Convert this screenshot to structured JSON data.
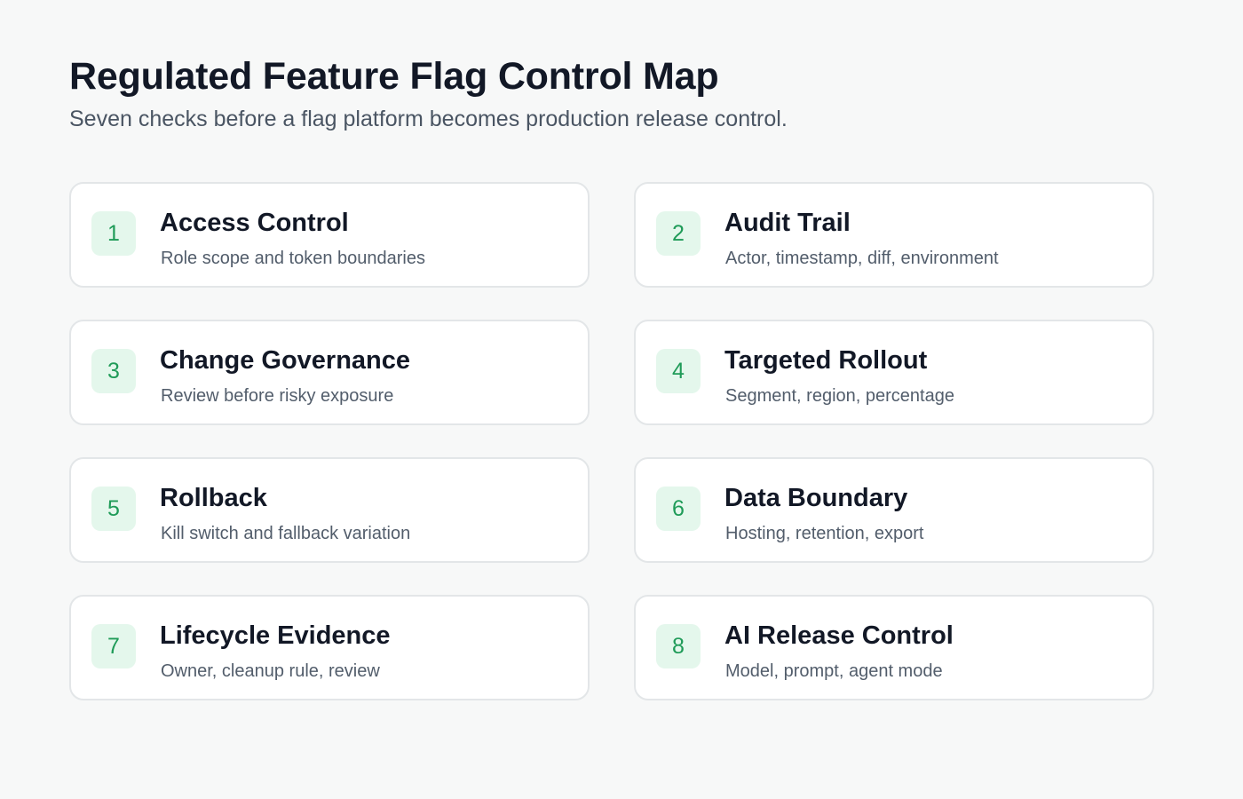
{
  "header": {
    "title": "Regulated Feature Flag Control Map",
    "subtitle": "Seven checks before a flag platform becomes production release control."
  },
  "theme": {
    "background": "#f7f8f8",
    "card_background": "#ffffff",
    "card_border": "#e3e6e8",
    "badge_background": "#e4f7ec",
    "badge_text": "#1f9b58",
    "title_text": "#121826",
    "muted_text": "#525d6b"
  },
  "checks": [
    {
      "number": "1",
      "title": "Access Control",
      "description": "Role scope and token boundaries"
    },
    {
      "number": "2",
      "title": "Audit Trail",
      "description": "Actor, timestamp, diff, environment"
    },
    {
      "number": "3",
      "title": "Change Governance",
      "description": "Review before risky exposure"
    },
    {
      "number": "4",
      "title": "Targeted Rollout",
      "description": "Segment, region, percentage"
    },
    {
      "number": "5",
      "title": "Rollback",
      "description": "Kill switch and fallback variation"
    },
    {
      "number": "6",
      "title": "Data Boundary",
      "description": "Hosting, retention, export"
    },
    {
      "number": "7",
      "title": "Lifecycle Evidence",
      "description": "Owner, cleanup rule, review"
    },
    {
      "number": "8",
      "title": "AI Release Control",
      "description": "Model, prompt, agent mode"
    }
  ]
}
